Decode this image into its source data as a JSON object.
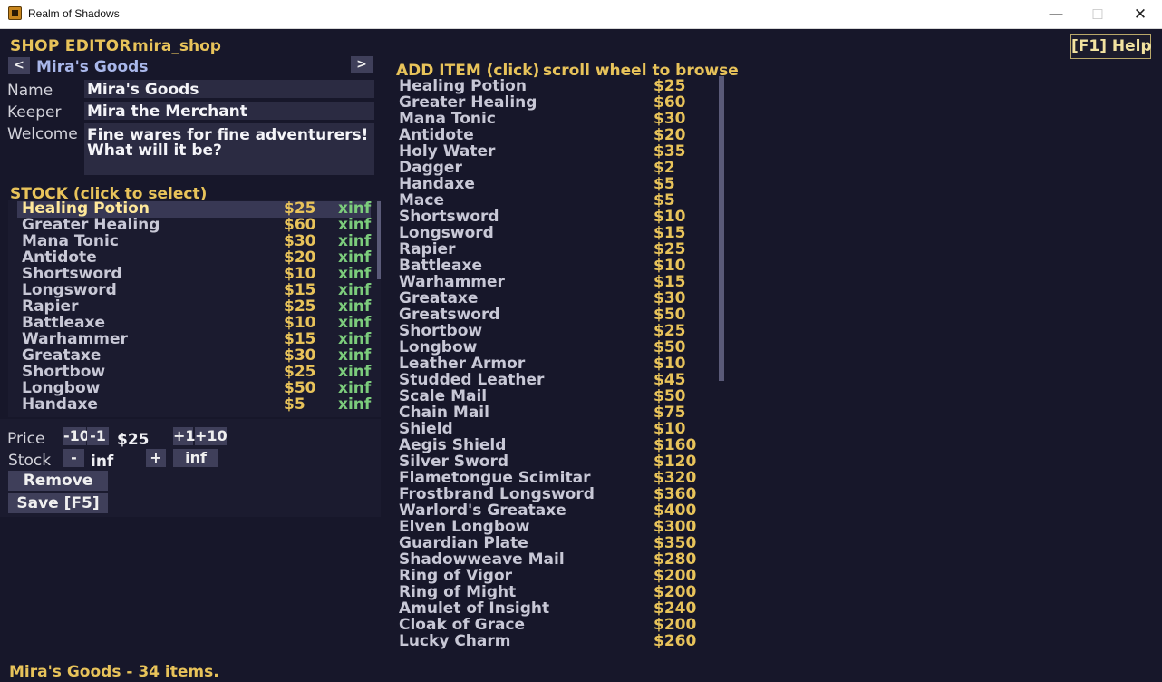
{
  "window": {
    "title": "Realm of Shadows"
  },
  "header": {
    "title": "SHOP EDITOR",
    "shop_id": "mira_shop",
    "help": "[F1] Help"
  },
  "nav": {
    "prev": "<",
    "next": ">",
    "shop_name": "Mira's Goods"
  },
  "form": {
    "name_label": "Name",
    "name_value": "Mira's Goods",
    "keeper_label": "Keeper",
    "keeper_value": "Mira the Merchant",
    "welcome_label": "Welcome",
    "welcome_line1": "Fine wares for fine adventurers!",
    "welcome_line2": "What will it be?"
  },
  "stock": {
    "header": "STOCK (click to select)",
    "items": [
      {
        "name": "Healing Potion",
        "price": "$25",
        "stock": "xinf"
      },
      {
        "name": "Greater Healing",
        "price": "$60",
        "stock": "xinf"
      },
      {
        "name": "Mana Tonic",
        "price": "$30",
        "stock": "xinf"
      },
      {
        "name": "Antidote",
        "price": "$20",
        "stock": "xinf"
      },
      {
        "name": "Shortsword",
        "price": "$10",
        "stock": "xinf"
      },
      {
        "name": "Longsword",
        "price": "$15",
        "stock": "xinf"
      },
      {
        "name": "Rapier",
        "price": "$25",
        "stock": "xinf"
      },
      {
        "name": "Battleaxe",
        "price": "$10",
        "stock": "xinf"
      },
      {
        "name": "Warhammer",
        "price": "$15",
        "stock": "xinf"
      },
      {
        "name": "Greataxe",
        "price": "$30",
        "stock": "xinf"
      },
      {
        "name": "Shortbow",
        "price": "$25",
        "stock": "xinf"
      },
      {
        "name": "Longbow",
        "price": "$50",
        "stock": "xinf"
      },
      {
        "name": "Handaxe",
        "price": "$5",
        "stock": "xinf"
      }
    ]
  },
  "editor": {
    "price_label": "Price",
    "minus10": "-10",
    "minus1": "-1",
    "price_value": "$25",
    "plus1": "+1",
    "plus10": "+10",
    "stock_label": "Stock",
    "stock_minus": "-",
    "stock_value": "inf",
    "stock_plus": "+",
    "stock_inf": "inf",
    "remove": "Remove",
    "save": "Save [F5]"
  },
  "add": {
    "header": "ADD ITEM (click)",
    "hint": "scroll wheel to browse",
    "items": [
      {
        "name": "Healing Potion",
        "price": "$25"
      },
      {
        "name": "Greater Healing",
        "price": "$60"
      },
      {
        "name": "Mana Tonic",
        "price": "$30"
      },
      {
        "name": "Antidote",
        "price": "$20"
      },
      {
        "name": "Holy Water",
        "price": "$35"
      },
      {
        "name": "Dagger",
        "price": "$2"
      },
      {
        "name": "Handaxe",
        "price": "$5"
      },
      {
        "name": "Mace",
        "price": "$5"
      },
      {
        "name": "Shortsword",
        "price": "$10"
      },
      {
        "name": "Longsword",
        "price": "$15"
      },
      {
        "name": "Rapier",
        "price": "$25"
      },
      {
        "name": "Battleaxe",
        "price": "$10"
      },
      {
        "name": "Warhammer",
        "price": "$15"
      },
      {
        "name": "Greataxe",
        "price": "$30"
      },
      {
        "name": "Greatsword",
        "price": "$50"
      },
      {
        "name": "Shortbow",
        "price": "$25"
      },
      {
        "name": "Longbow",
        "price": "$50"
      },
      {
        "name": "Leather Armor",
        "price": "$10"
      },
      {
        "name": "Studded Leather",
        "price": "$45"
      },
      {
        "name": "Scale Mail",
        "price": "$50"
      },
      {
        "name": "Chain Mail",
        "price": "$75"
      },
      {
        "name": "Shield",
        "price": "$10"
      },
      {
        "name": "Aegis Shield",
        "price": "$160"
      },
      {
        "name": "Silver Sword",
        "price": "$120"
      },
      {
        "name": "Flametongue Scimitar",
        "price": "$320"
      },
      {
        "name": "Frostbrand Longsword",
        "price": "$360"
      },
      {
        "name": "Warlord's Greataxe",
        "price": "$400"
      },
      {
        "name": "Elven Longbow",
        "price": "$300"
      },
      {
        "name": "Guardian Plate",
        "price": "$350"
      },
      {
        "name": "Shadowweave Mail",
        "price": "$280"
      },
      {
        "name": "Ring of Vigor",
        "price": "$200"
      },
      {
        "name": "Ring of Might",
        "price": "$200"
      },
      {
        "name": "Amulet of Insight",
        "price": "$240"
      },
      {
        "name": "Cloak of Grace",
        "price": "$200"
      },
      {
        "name": "Lucky Charm",
        "price": "$260"
      }
    ]
  },
  "status": "Mira's Goods - 34 items."
}
